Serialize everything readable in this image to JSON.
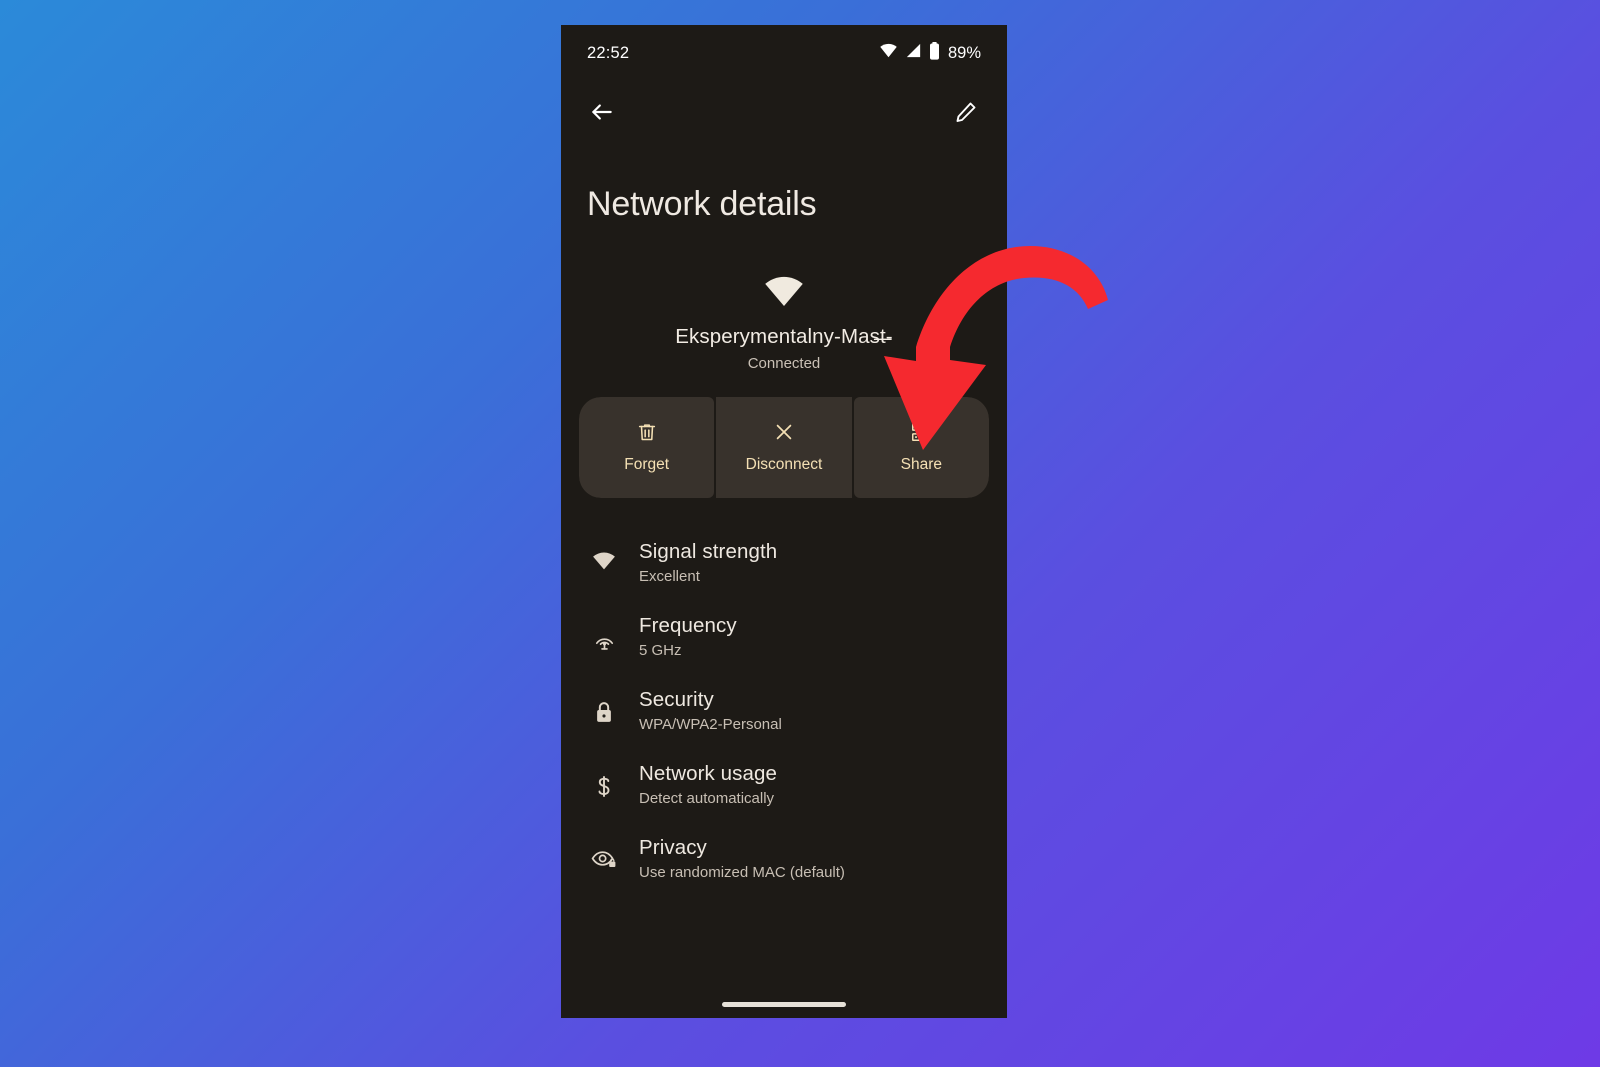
{
  "background": {
    "gradient_from": "#2b8ad9",
    "gradient_to": "#6e3ae6"
  },
  "phone": {
    "screen_bg": "#1d1a16"
  },
  "status_bar": {
    "time": "22:52",
    "battery_percent": "89%",
    "icons": [
      "wifi-icon",
      "cellular-signal-icon",
      "battery-icon"
    ]
  },
  "toolbar": {
    "back_icon": "back-arrow-icon",
    "edit_icon": "pencil-edit-icon"
  },
  "header": {
    "title": "Network details"
  },
  "hero": {
    "wifi_icon": "wifi-full-icon",
    "ssid": "Eksperymentalny-Mas̶t̶-",
    "status": "Connected"
  },
  "actions": {
    "accent_color": "#f4e0b4",
    "button_bg": "#38322c",
    "items": [
      {
        "label": "Forget",
        "icon": "trash-icon"
      },
      {
        "label": "Disconnect",
        "icon": "close-x-icon"
      },
      {
        "label": "Share",
        "icon": "qr-code-icon"
      }
    ]
  },
  "details": {
    "rows": [
      {
        "title": "Signal strength",
        "value": "Excellent",
        "icon": "wifi-icon"
      },
      {
        "title": "Frequency",
        "value": "5 GHz",
        "icon": "broadcast-icon"
      },
      {
        "title": "Security",
        "value": "WPA/WPA2-Personal",
        "icon": "lock-icon"
      },
      {
        "title": "Network usage",
        "value": "Detect automatically",
        "icon": "dollar-icon"
      },
      {
        "title": "Privacy",
        "value": "Use randomized MAC (default)",
        "icon": "eye-lock-icon"
      }
    ]
  },
  "annotation": {
    "color": "#f5292f",
    "shape": "curved-down-arrow",
    "points_to": "Share"
  },
  "navigation": {
    "gesture_pill": "home-gesture-pill"
  }
}
